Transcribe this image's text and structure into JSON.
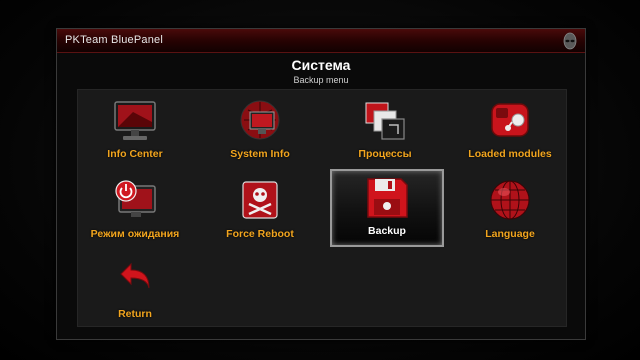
{
  "window": {
    "title": "PKTeam BluePanel"
  },
  "header": {
    "title": "Система",
    "subtitle": "Backup menu"
  },
  "menu": {
    "items": [
      {
        "label": "Info Center",
        "icon": "monitor-icon"
      },
      {
        "label": "System Info",
        "icon": "monitor-sphere-icon"
      },
      {
        "label": "Процессы",
        "icon": "windows-stack-icon"
      },
      {
        "label": "Loaded modules",
        "icon": "module-chip-icon"
      },
      {
        "label": "Режим ожидания",
        "icon": "standby-monitor-icon"
      },
      {
        "label": "Force Reboot",
        "icon": "skull-crossbones-icon"
      },
      {
        "label": "Backup",
        "icon": "floppy-disk-icon"
      },
      {
        "label": "Language",
        "icon": "globe-icon"
      },
      {
        "label": "Return",
        "icon": "return-arrow-icon"
      }
    ],
    "selected_label": "Backup"
  },
  "colors": {
    "accent": "#f2a51e",
    "red": "#c0141a",
    "titlebar": "#2a0303"
  }
}
